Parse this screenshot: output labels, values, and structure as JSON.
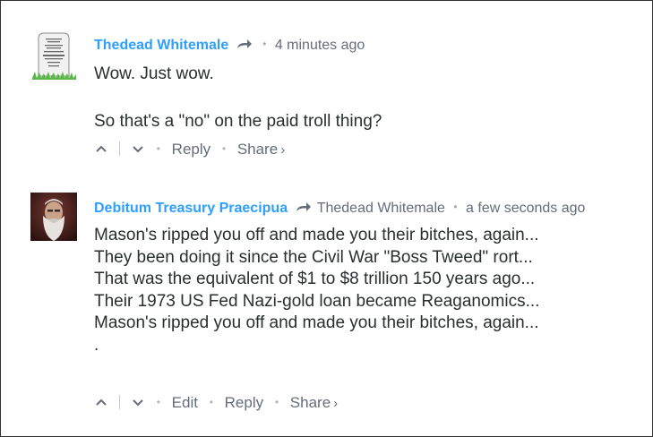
{
  "comments": [
    {
      "author": "Thedead Whitemale",
      "reply_to": "",
      "timestamp": "4 minutes ago",
      "paragraphs": [
        "Wow. Just wow.",
        "So that's a \"no\" on the paid troll thing?"
      ],
      "actions": {
        "reply": "Reply",
        "share": "Share",
        "share_chevron": "›"
      },
      "avatar_icon": "tombstone-icon"
    },
    {
      "author": "Debitum Treasury Praecipua",
      "reply_to": "Thedead Whitemale",
      "timestamp": "a few seconds ago",
      "lines": [
        "Mason's ripped you off and made you their bitches, again...",
        "They been doing it since the Civil War \"Boss Tweed\" rort...",
        "That was the equivalent of $1 to $8 trillion 150 years ago...",
        "Their 1973 US Fed Nazi-gold loan became Reaganomics...",
        "Mason's ripped you off and made you their bitches, again...",
        "."
      ],
      "actions": {
        "edit": "Edit",
        "reply": "Reply",
        "share": "Share",
        "share_chevron": "›"
      },
      "avatar_icon": "bearded-man-photo"
    }
  ],
  "colors": {
    "author": "#2e9fff",
    "meta": "#656c7a",
    "text": "#2a2e2e",
    "border": "#333333"
  }
}
